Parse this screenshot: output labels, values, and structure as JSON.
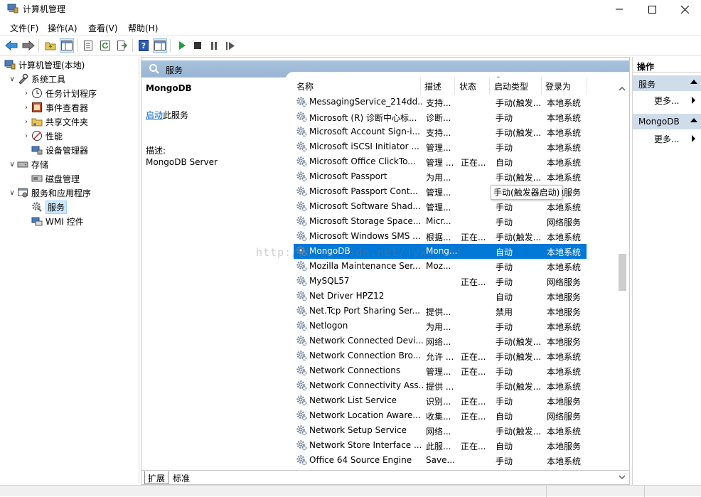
{
  "window": {
    "title": "计算机管理"
  },
  "menu": [
    "文件(F)",
    "操作(A)",
    "查看(V)",
    "帮助(H)"
  ],
  "tree": {
    "root": "计算机管理(本地)",
    "system_tools": "系统工具",
    "task_scheduler": "任务计划程序",
    "event_viewer": "事件查看器",
    "shared_folders": "共享文件夹",
    "performance": "性能",
    "device_manager": "设备管理器",
    "storage": "存储",
    "disk_management": "磁盘管理",
    "services_apps": "服务和应用程序",
    "services": "服务",
    "wmi": "WMI 控件"
  },
  "panel": {
    "header": "服务",
    "selected_name": "MongoDB",
    "start_link": "启动",
    "start_suffix": "此服务",
    "desc_label": "描述:",
    "desc_value": "MongoDB Server"
  },
  "columns": [
    "名称",
    "描述",
    "状态",
    "启动类型",
    "登录为"
  ],
  "services": [
    {
      "name": "MessagingService_214dd...",
      "desc": "支持...",
      "status": "",
      "startup": "手动(触发...",
      "logon": "本地系统"
    },
    {
      "name": "Microsoft (R) 诊断中心标...",
      "desc": "诊断...",
      "status": "",
      "startup": "手动",
      "logon": "本地系统"
    },
    {
      "name": "Microsoft Account Sign-i...",
      "desc": "支持...",
      "status": "",
      "startup": "手动(触发...",
      "logon": "本地系统"
    },
    {
      "name": "Microsoft iSCSI Initiator ...",
      "desc": "管理...",
      "status": "",
      "startup": "手动",
      "logon": "本地系统"
    },
    {
      "name": "Microsoft Office ClickTo...",
      "desc": "管理 ...",
      "status": "正在...",
      "startup": "自动",
      "logon": "本地系统"
    },
    {
      "name": "Microsoft Passport",
      "desc": "为用...",
      "status": "",
      "startup": "手动(触发...",
      "logon": "本地系统"
    },
    {
      "name": "Microsoft Passport Cont...",
      "desc": "管理...",
      "status": "",
      "startup": "",
      "logon": "本地服务"
    },
    {
      "name": "Microsoft Software Shad...",
      "desc": "管理...",
      "status": "",
      "startup": "手动",
      "logon": "本地系统"
    },
    {
      "name": "Microsoft Storage Space...",
      "desc": "Micr...",
      "status": "",
      "startup": "手动",
      "logon": "网络服务"
    },
    {
      "name": "Microsoft Windows SMS ...",
      "desc": "根据...",
      "status": "正在...",
      "startup": "手动(触发...",
      "logon": "本地系统"
    },
    {
      "name": "MongoDB",
      "desc": "Mong...",
      "status": "",
      "startup": "自动",
      "logon": "本地系统"
    },
    {
      "name": "Mozilla Maintenance Ser...",
      "desc": "Moz...",
      "status": "",
      "startup": "手动",
      "logon": "本地系统"
    },
    {
      "name": "MySQL57",
      "desc": "",
      "status": "正在...",
      "startup": "手动",
      "logon": "网络服务"
    },
    {
      "name": "Net Driver HPZ12",
      "desc": "",
      "status": "",
      "startup": "自动",
      "logon": "本地服务"
    },
    {
      "name": "Net.Tcp Port Sharing Ser...",
      "desc": "提供...",
      "status": "",
      "startup": "禁用",
      "logon": "本地服务"
    },
    {
      "name": "Netlogon",
      "desc": "为用...",
      "status": "",
      "startup": "手动",
      "logon": "本地系统"
    },
    {
      "name": "Network Connected Devi...",
      "desc": "网络...",
      "status": "",
      "startup": "手动(触发...",
      "logon": "本地服务"
    },
    {
      "name": "Network Connection Bro...",
      "desc": "允许 ...",
      "status": "正在...",
      "startup": "手动(触发...",
      "logon": "本地系统"
    },
    {
      "name": "Network Connections",
      "desc": "管理...",
      "status": "正在...",
      "startup": "手动",
      "logon": "本地系统"
    },
    {
      "name": "Network Connectivity Ass...",
      "desc": "提供 ...",
      "status": "",
      "startup": "手动(触发...",
      "logon": "本地系统"
    },
    {
      "name": "Network List Service",
      "desc": "识别...",
      "status": "正在...",
      "startup": "手动",
      "logon": "本地服务"
    },
    {
      "name": "Network Location Aware...",
      "desc": "收集...",
      "status": "正在...",
      "startup": "自动",
      "logon": "网络服务"
    },
    {
      "name": "Network Setup Service",
      "desc": "网络...",
      "status": "",
      "startup": "手动(触发...",
      "logon": "本地系统"
    },
    {
      "name": "Network Store Interface ...",
      "desc": "此服...",
      "status": "正在...",
      "startup": "自动",
      "logon": "本地服务"
    },
    {
      "name": "Office 64 Source Engine",
      "desc": "Save...",
      "status": "",
      "startup": "手动",
      "logon": "本地系统"
    }
  ],
  "tooltip": "手动(触发器启动)",
  "watermark": "http://blog.csdn.net/jyxingdf",
  "tabs": [
    "扩展",
    "标准"
  ],
  "actions": {
    "title": "操作",
    "section1": "服务",
    "more1": "更多...",
    "section2": "MongoDB",
    "more2": "更多..."
  },
  "colors": {
    "selection": "#0078d7",
    "panel_header": "#a9c3dd",
    "action_section": "#cfdcea"
  }
}
